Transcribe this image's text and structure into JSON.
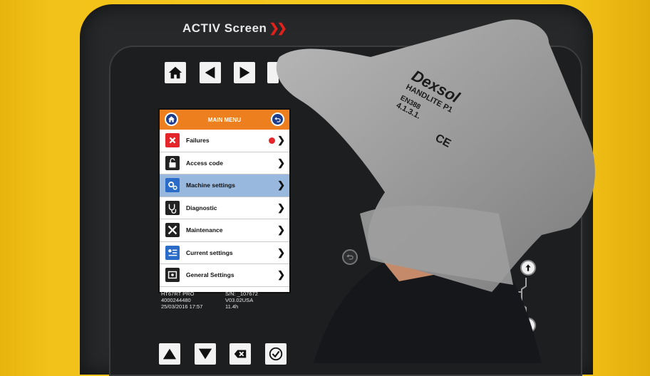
{
  "device": {
    "brand": "ACTIV Screen",
    "brand_chevrons": "❯❯"
  },
  "hardware_buttons_top": [
    "home-icon",
    "left-arrow-icon",
    "right-arrow-icon"
  ],
  "hardware_buttons_bottom": [
    "up-triangle-icon",
    "down-triangle-icon",
    "backspace-icon",
    "check-icon"
  ],
  "screen": {
    "title": "MAIN MENU",
    "items": [
      {
        "label": "Failures",
        "icon": "failure-icon",
        "icon_bg": "#e4262a",
        "selected": false,
        "badge": true
      },
      {
        "label": "Access code",
        "icon": "lock-icon",
        "icon_bg": "#222222",
        "selected": false,
        "badge": false
      },
      {
        "label": "Machine settings",
        "icon": "gears-icon",
        "icon_bg": "#2b6cc8",
        "selected": true,
        "badge": false
      },
      {
        "label": "Diagnostic",
        "icon": "stethoscope-icon",
        "icon_bg": "#222222",
        "selected": false,
        "badge": false
      },
      {
        "label": "Maintenance",
        "icon": "tools-icon",
        "icon_bg": "#222222",
        "selected": false,
        "badge": false
      },
      {
        "label": "Current settings",
        "icon": "settings-list-icon",
        "icon_bg": "#2b6cc8",
        "selected": false,
        "badge": false
      },
      {
        "label": "General Settings",
        "icon": "general-settings-icon",
        "icon_bg": "#222222",
        "selected": false,
        "badge": false
      }
    ],
    "chevron": "❯"
  },
  "info": {
    "model": "HT67RT PRO",
    "serial": "S/N: _107672",
    "part": "4000244480",
    "version": "V03.02USA",
    "datetime": "25/03/2016 17:57",
    "hours": "11.4h"
  },
  "glove": {
    "brand": "Dexsol",
    "model": "HANDLITE P1",
    "standard": "EN388",
    "rating": "4.1.3.1.",
    "mark": "CE"
  },
  "colors": {
    "header": "#ee7f1f",
    "selected": "#98b8de",
    "round_button": "#1d3d8c",
    "background": "#f7c81c"
  }
}
